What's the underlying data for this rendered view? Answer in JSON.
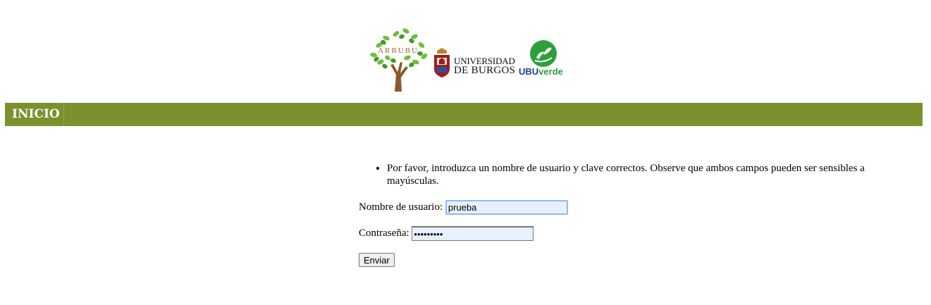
{
  "logos": {
    "arbubu": {
      "text": "ARBUBU"
    },
    "ubu": {
      "line1": "UNIVERSIDAD",
      "line2": "DE BURGOS"
    },
    "ubuverde": {
      "part1": "UBU",
      "part2": "verde"
    }
  },
  "nav": {
    "items": [
      {
        "label": "INICIO"
      }
    ]
  },
  "login": {
    "errors": [
      "Por favor, introduzca un nombre de usuario y clave correctos. Observe que ambos campos pueden ser sensibles a mayúsculas."
    ],
    "username_label": "Nombre de usuario:",
    "username_value": "prueba",
    "password_label": "Contraseña:",
    "password_value": "•••••••••",
    "submit_label": "Enviar"
  },
  "colors": {
    "navbar": "#7a912e",
    "nav_text": "#ffffff",
    "input_bg": "#e8f0fe"
  }
}
